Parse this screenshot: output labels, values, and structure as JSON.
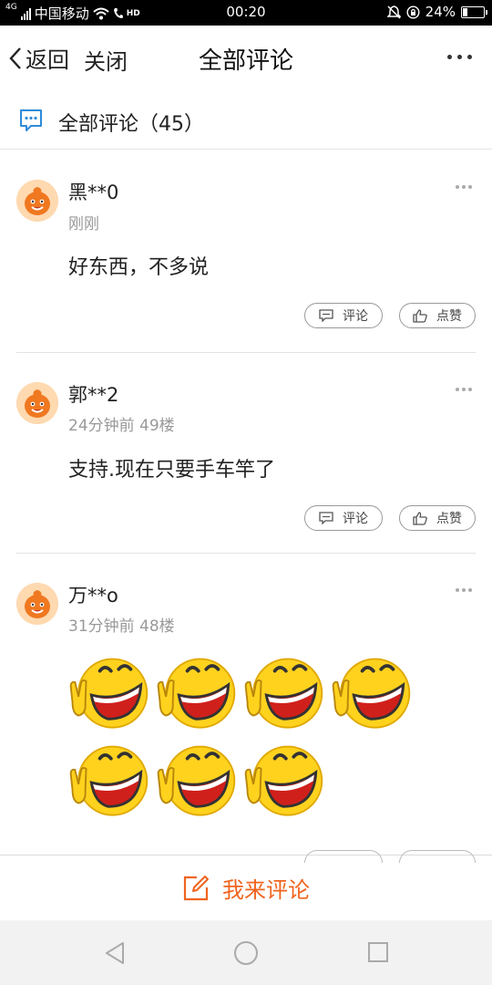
{
  "status": {
    "network_type": "4G",
    "carrier": "中国移动",
    "hd_badge": "HD",
    "time": "00:20",
    "battery": "24%",
    "battery_level": 0.24
  },
  "nav": {
    "back_label": "返回",
    "close_label": "关闭",
    "title": "全部评论"
  },
  "section": {
    "title": "全部评论（45）"
  },
  "comments": [
    {
      "name": "黑**0",
      "meta": "刚刚",
      "text": "好东西，不多说",
      "reply_label": "评论",
      "like_label": "点赞"
    },
    {
      "name": "郭**2",
      "meta": "24分钟前  49楼",
      "text": "支持.现在只要手车竿了",
      "reply_label": "评论",
      "like_label": "点赞"
    },
    {
      "name": "万**o",
      "meta": "31分钟前  48楼",
      "emoji_count": 7
    }
  ],
  "bottom": {
    "cta_label": "我来评论"
  },
  "colors": {
    "accent": "#f0641e",
    "icon_blue": "#2f8ad8",
    "muted_text": "#999999"
  }
}
